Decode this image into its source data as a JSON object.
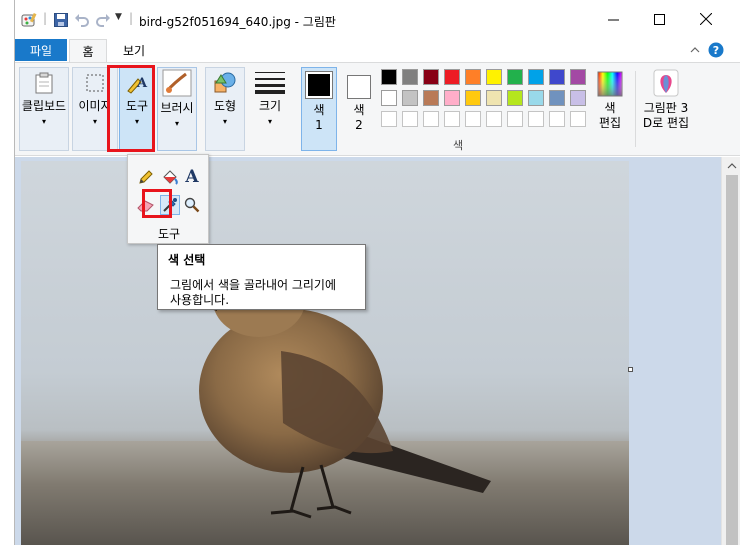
{
  "window": {
    "title": "bird-g52f051694_640.jpg - 그림판",
    "qa_separator": "|",
    "qa_dropdown_glyph": "▼"
  },
  "tabs": {
    "file": "파일",
    "home": "홈",
    "view": "보기"
  },
  "ribbon": {
    "clipboard": "클립보드",
    "image": "이미지",
    "tools": "도구",
    "brushes": "브러시",
    "shapes": "도형",
    "size": "크기",
    "color1_line1": "색",
    "color1_line2": "1",
    "color2_line1": "색",
    "color2_line2": "2",
    "edit_colors_line1": "색",
    "edit_colors_line2": "편집",
    "paint3d_line1": "그림판 3",
    "paint3d_line2": "D로 편집",
    "colors_group_label": "색",
    "dropdown_arrow": "▾"
  },
  "palette": {
    "row1": [
      "#000000",
      "#7f7f7f",
      "#880015",
      "#ed1c24",
      "#ff7f27",
      "#fff200",
      "#22b14c",
      "#00a2e8",
      "#3f48cc",
      "#a349a4"
    ],
    "row2": [
      "#ffffff",
      "#c3c3c3",
      "#b97a57",
      "#ffaec9",
      "#ffc90e",
      "#efe4b0",
      "#b5e61d",
      "#99d9ea",
      "#7092be",
      "#c8bfe7"
    ]
  },
  "tools_panel": {
    "label": "도구",
    "text_tool_glyph": "A"
  },
  "tooltip": {
    "title": "색 선택",
    "body_line1": "그림에서 색을 골라내어 그리기에",
    "body_line2": "사용합니다."
  },
  "colors": {
    "accent": "#1979ca",
    "highlight": "#e8141c"
  }
}
